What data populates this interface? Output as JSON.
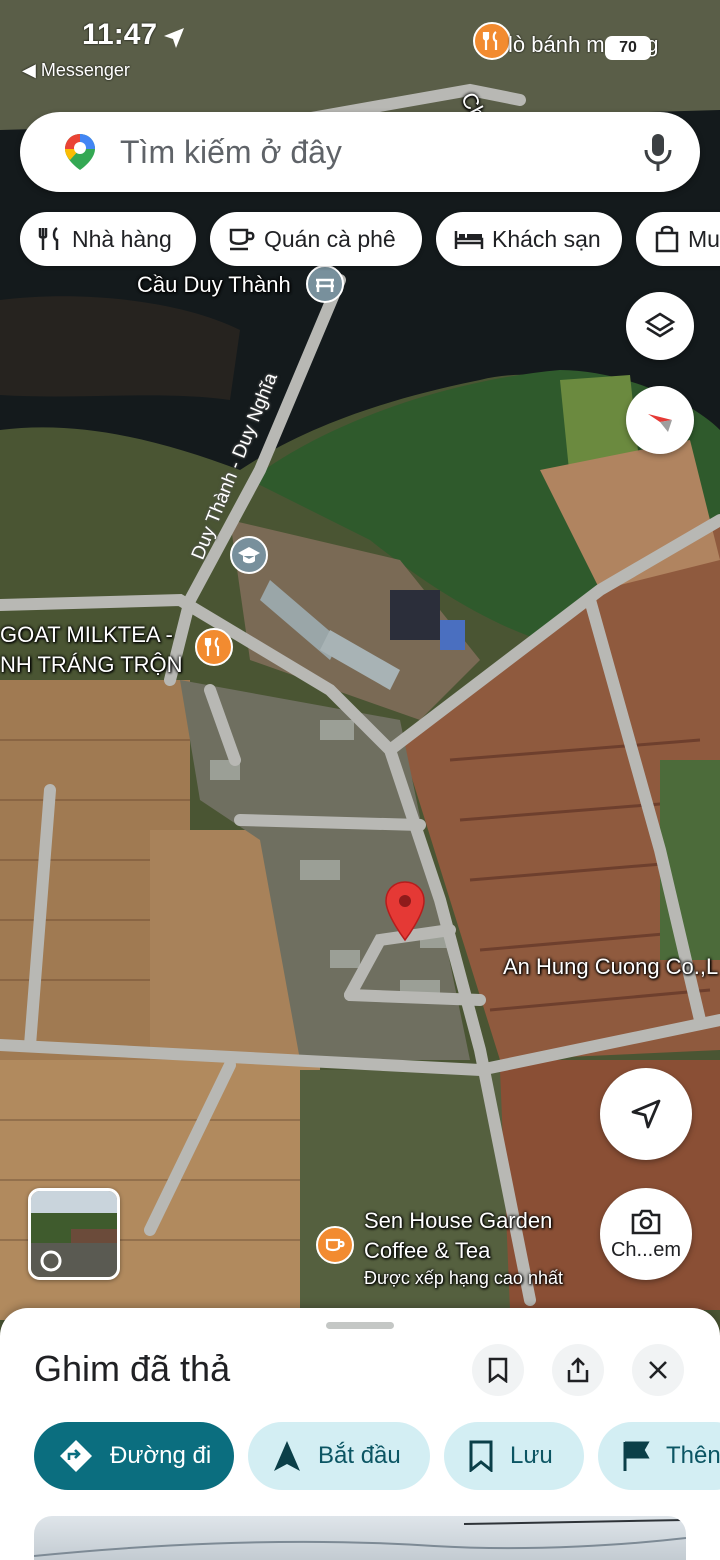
{
  "status_bar": {
    "time": "11:47",
    "back_app": "Messenger",
    "right_overlay_text": "lò bánh m vang",
    "battery": "70"
  },
  "search": {
    "placeholder": "Tìm kiếm ở đây"
  },
  "chips": [
    {
      "label": "Nhà hàng",
      "icon": "fork-knife-icon"
    },
    {
      "label": "Quán cà phê",
      "icon": "coffee-cup-icon"
    },
    {
      "label": "Khách sạn",
      "icon": "bed-icon"
    },
    {
      "label": "Mu",
      "icon": "shopping-bag-icon"
    }
  ],
  "map": {
    "labels": {
      "bridge": "Cầu Duy Thành",
      "road": "Duy Thành - Duy Nghĩa",
      "milktea_line1": "GOAT MILKTEA -",
      "milktea_line2": "NH TRÁNG TRỘN",
      "company": "An Hung Cuong Co.,L",
      "cafe_line1": "Sen House Garden",
      "cafe_line2": "Coffee & Tea",
      "cafe_note": "Được xếp hạng cao nhất",
      "road_fragment": "Ch"
    }
  },
  "buttons": {
    "lens_label": "Ch...em"
  },
  "sheet": {
    "title": "Ghim đã thả",
    "actions": [
      {
        "label": "Đường đi",
        "icon": "directions-icon"
      },
      {
        "label": "Bắt đầu",
        "icon": "navigation-arrow-icon"
      },
      {
        "label": "Lưu",
        "icon": "bookmark-icon"
      },
      {
        "label": "Thên",
        "icon": "flag-icon"
      }
    ]
  },
  "colors": {
    "accent": "#0b6e7f",
    "accent_light": "#d3eef3",
    "pin_red": "#e53935",
    "poi_orange": "#f28b30"
  }
}
